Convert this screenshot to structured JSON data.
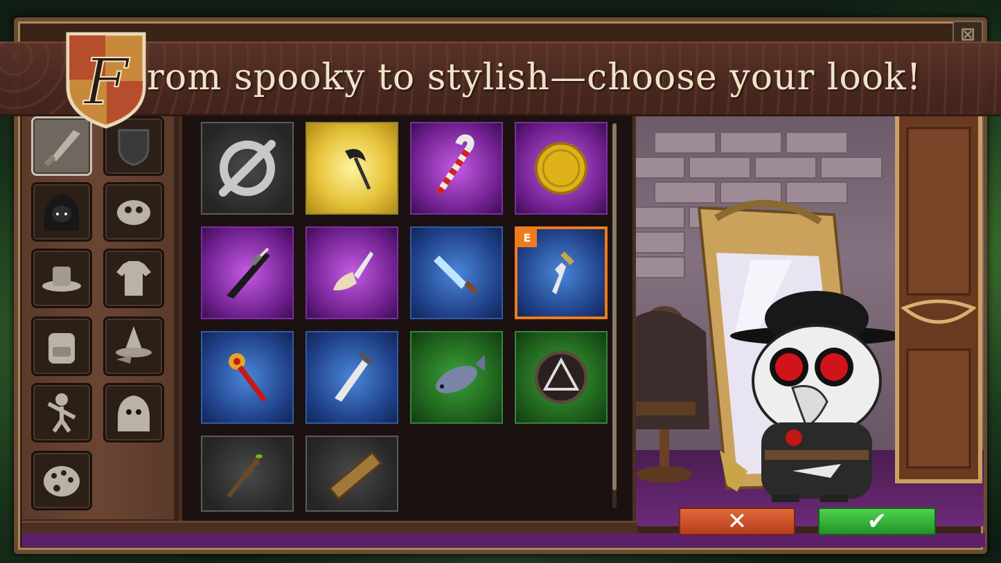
{
  "banner": {
    "crest_letter": "F",
    "text": "rom spooky to stylish—choose your look!"
  },
  "colors": {
    "selected_border": "#f07b1d",
    "cancel_button": "#c24a24",
    "confirm_button": "#36b23a"
  },
  "categories": [
    {
      "icon": "dagger-icon",
      "active": true
    },
    {
      "icon": "shield-icon",
      "active": false
    },
    {
      "icon": "hood-icon",
      "active": false
    },
    {
      "icon": "mask-icon",
      "active": false
    },
    {
      "icon": "hat-icon",
      "active": false
    },
    {
      "icon": "shirt-icon",
      "active": false
    },
    {
      "icon": "backpack-icon",
      "active": false
    },
    {
      "icon": "witch-hat-icon",
      "active": false
    },
    {
      "icon": "dance-icon",
      "active": false
    },
    {
      "icon": "reaper-icon",
      "active": false
    },
    {
      "icon": "palette-icon",
      "active": false
    }
  ],
  "items": [
    {
      "icon": "none-icon",
      "rarity": "gray"
    },
    {
      "icon": "scythe-icon",
      "rarity": "gold"
    },
    {
      "icon": "candy-cane-icon",
      "rarity": "purple"
    },
    {
      "icon": "gold-coin-icon",
      "rarity": "purple"
    },
    {
      "icon": "katana-icon",
      "rarity": "purple"
    },
    {
      "icon": "bone-knife-icon",
      "rarity": "purple"
    },
    {
      "icon": "ice-dagger-icon",
      "rarity": "blue"
    },
    {
      "icon": "kris-dagger-icon",
      "rarity": "blue",
      "equipped": true,
      "badge": "E"
    },
    {
      "icon": "scepter-icon",
      "rarity": "blue"
    },
    {
      "icon": "short-sword-icon",
      "rarity": "blue"
    },
    {
      "icon": "fish-icon",
      "rarity": "green"
    },
    {
      "icon": "rune-shield-icon",
      "rarity": "green"
    },
    {
      "icon": "twig-icon",
      "rarity": "gray"
    },
    {
      "icon": "wooden-plank-icon",
      "rarity": "gray"
    }
  ],
  "buttons": {
    "cancel": "✕",
    "confirm": "✔",
    "close": "⊠"
  }
}
